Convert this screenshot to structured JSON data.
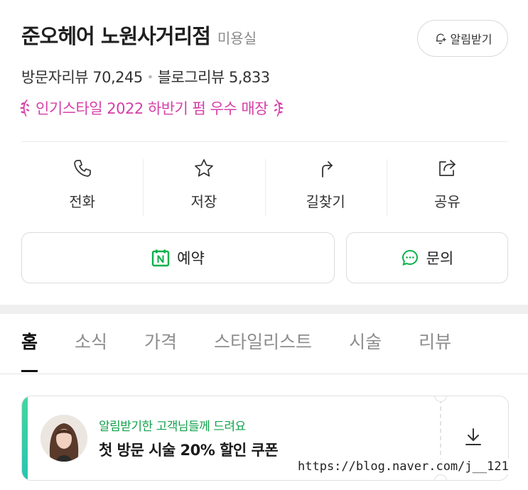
{
  "place": {
    "name": "준오헤어 노원사거리점",
    "category": "미용실"
  },
  "alarm_button": {
    "label": "알림받기",
    "icon": "bell-plus-icon"
  },
  "reviews": {
    "visitor": "방문자리뷰 70,245",
    "separator": "•",
    "blog": "블로그리뷰 5,833"
  },
  "award": {
    "text": "인기스타일 2022 하반기 펌 우수 매장",
    "color": "#d63fa8"
  },
  "actions": [
    {
      "label": "전화",
      "icon": "phone-icon"
    },
    {
      "label": "저장",
      "icon": "star-icon"
    },
    {
      "label": "길찾기",
      "icon": "directions-icon"
    },
    {
      "label": "공유",
      "icon": "share-icon"
    }
  ],
  "buttons": {
    "reserve": {
      "label": "예약",
      "icon": "naver-booking-icon",
      "color": "#0bb14a"
    },
    "inquiry": {
      "label": "문의",
      "icon": "chat-bubble-icon",
      "color": "#0bb14a"
    }
  },
  "tabs": [
    "홈",
    "소식",
    "가격",
    "스타일리스트",
    "시술",
    "리뷰"
  ],
  "active_tab": "홈",
  "coupon": {
    "subtitle": "알림받기한 고객님들께 드려요",
    "title": "첫 방문 시술 20% 할인 쿠폰",
    "icon": "download-icon",
    "accent": "#3dd0a5"
  },
  "watermark": "https://blog.naver.com/j__121"
}
